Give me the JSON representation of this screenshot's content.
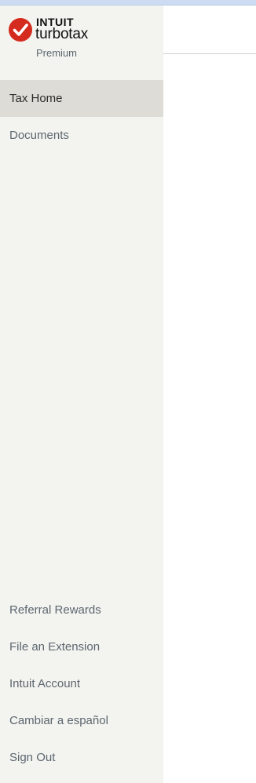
{
  "brand": {
    "company": "INTUIT",
    "product": "turbotax",
    "edition": "Premium",
    "check_color": "#d52b1e"
  },
  "nav": {
    "primary": [
      {
        "label": "Tax Home",
        "active": true
      },
      {
        "label": "Documents",
        "active": false
      }
    ],
    "secondary": [
      {
        "label": "Referral Rewards"
      },
      {
        "label": "File an Extension"
      },
      {
        "label": "Intuit Account"
      },
      {
        "label": "Cambiar a español"
      },
      {
        "label": "Sign Out"
      }
    ]
  }
}
